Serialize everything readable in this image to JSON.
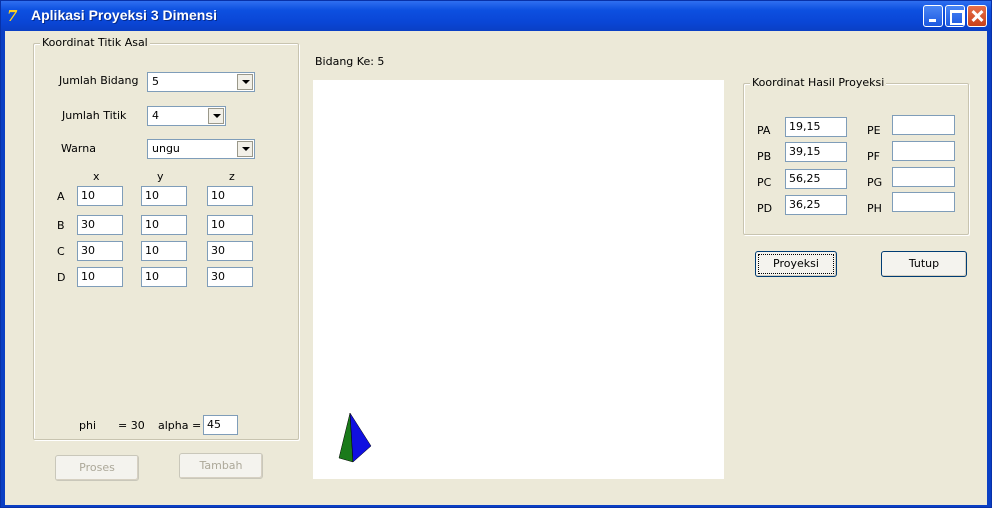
{
  "window": {
    "title": "Aplikasi Proyeksi 3 Dimensi",
    "icon": "app-logo-icon",
    "icon_glyph": "7",
    "titlebar_color": "#0a46d6"
  },
  "source_group": {
    "legend": "Koordinat Titik Asal",
    "jumlah_bidang_label": "Jumlah Bidang",
    "jumlah_bidang_value": "5",
    "jumlah_titik_label": "Jumlah Titik",
    "jumlah_titik_value": "4",
    "warna_label": "Warna",
    "warna_value": "ungu",
    "headers": [
      "x",
      "y",
      "z"
    ],
    "points": [
      {
        "label": "A",
        "x": "10",
        "y": "10",
        "z": "10"
      },
      {
        "label": "B",
        "x": "30",
        "y": "10",
        "z": "10"
      },
      {
        "label": "C",
        "x": "30",
        "y": "10",
        "z": "30"
      },
      {
        "label": "D",
        "x": "10",
        "y": "10",
        "z": "30"
      }
    ],
    "phi_label": "phi",
    "phi_text": "= 30",
    "alpha_label": "alpha =",
    "alpha_value": "45"
  },
  "buttons": {
    "proses": "Proses",
    "tambah": "Tambah",
    "proyeksi": "Proyeksi",
    "tutup": "Tutup"
  },
  "canvas": {
    "bidang_label": "Bidang Ke: 5",
    "shape_colors": {
      "left_face": "#1a7a1a",
      "right_face": "#1010e0"
    }
  },
  "result_group": {
    "legend": "Koordinat Hasil Proyeksi",
    "left": [
      {
        "label": "PA",
        "value": "19,15"
      },
      {
        "label": "PB",
        "value": "39,15"
      },
      {
        "label": "PC",
        "value": "56,25"
      },
      {
        "label": "PD",
        "value": "36,25"
      }
    ],
    "right": [
      {
        "label": "PE",
        "value": ""
      },
      {
        "label": "PF",
        "value": ""
      },
      {
        "label": "PG",
        "value": ""
      },
      {
        "label": "PH",
        "value": ""
      }
    ]
  }
}
